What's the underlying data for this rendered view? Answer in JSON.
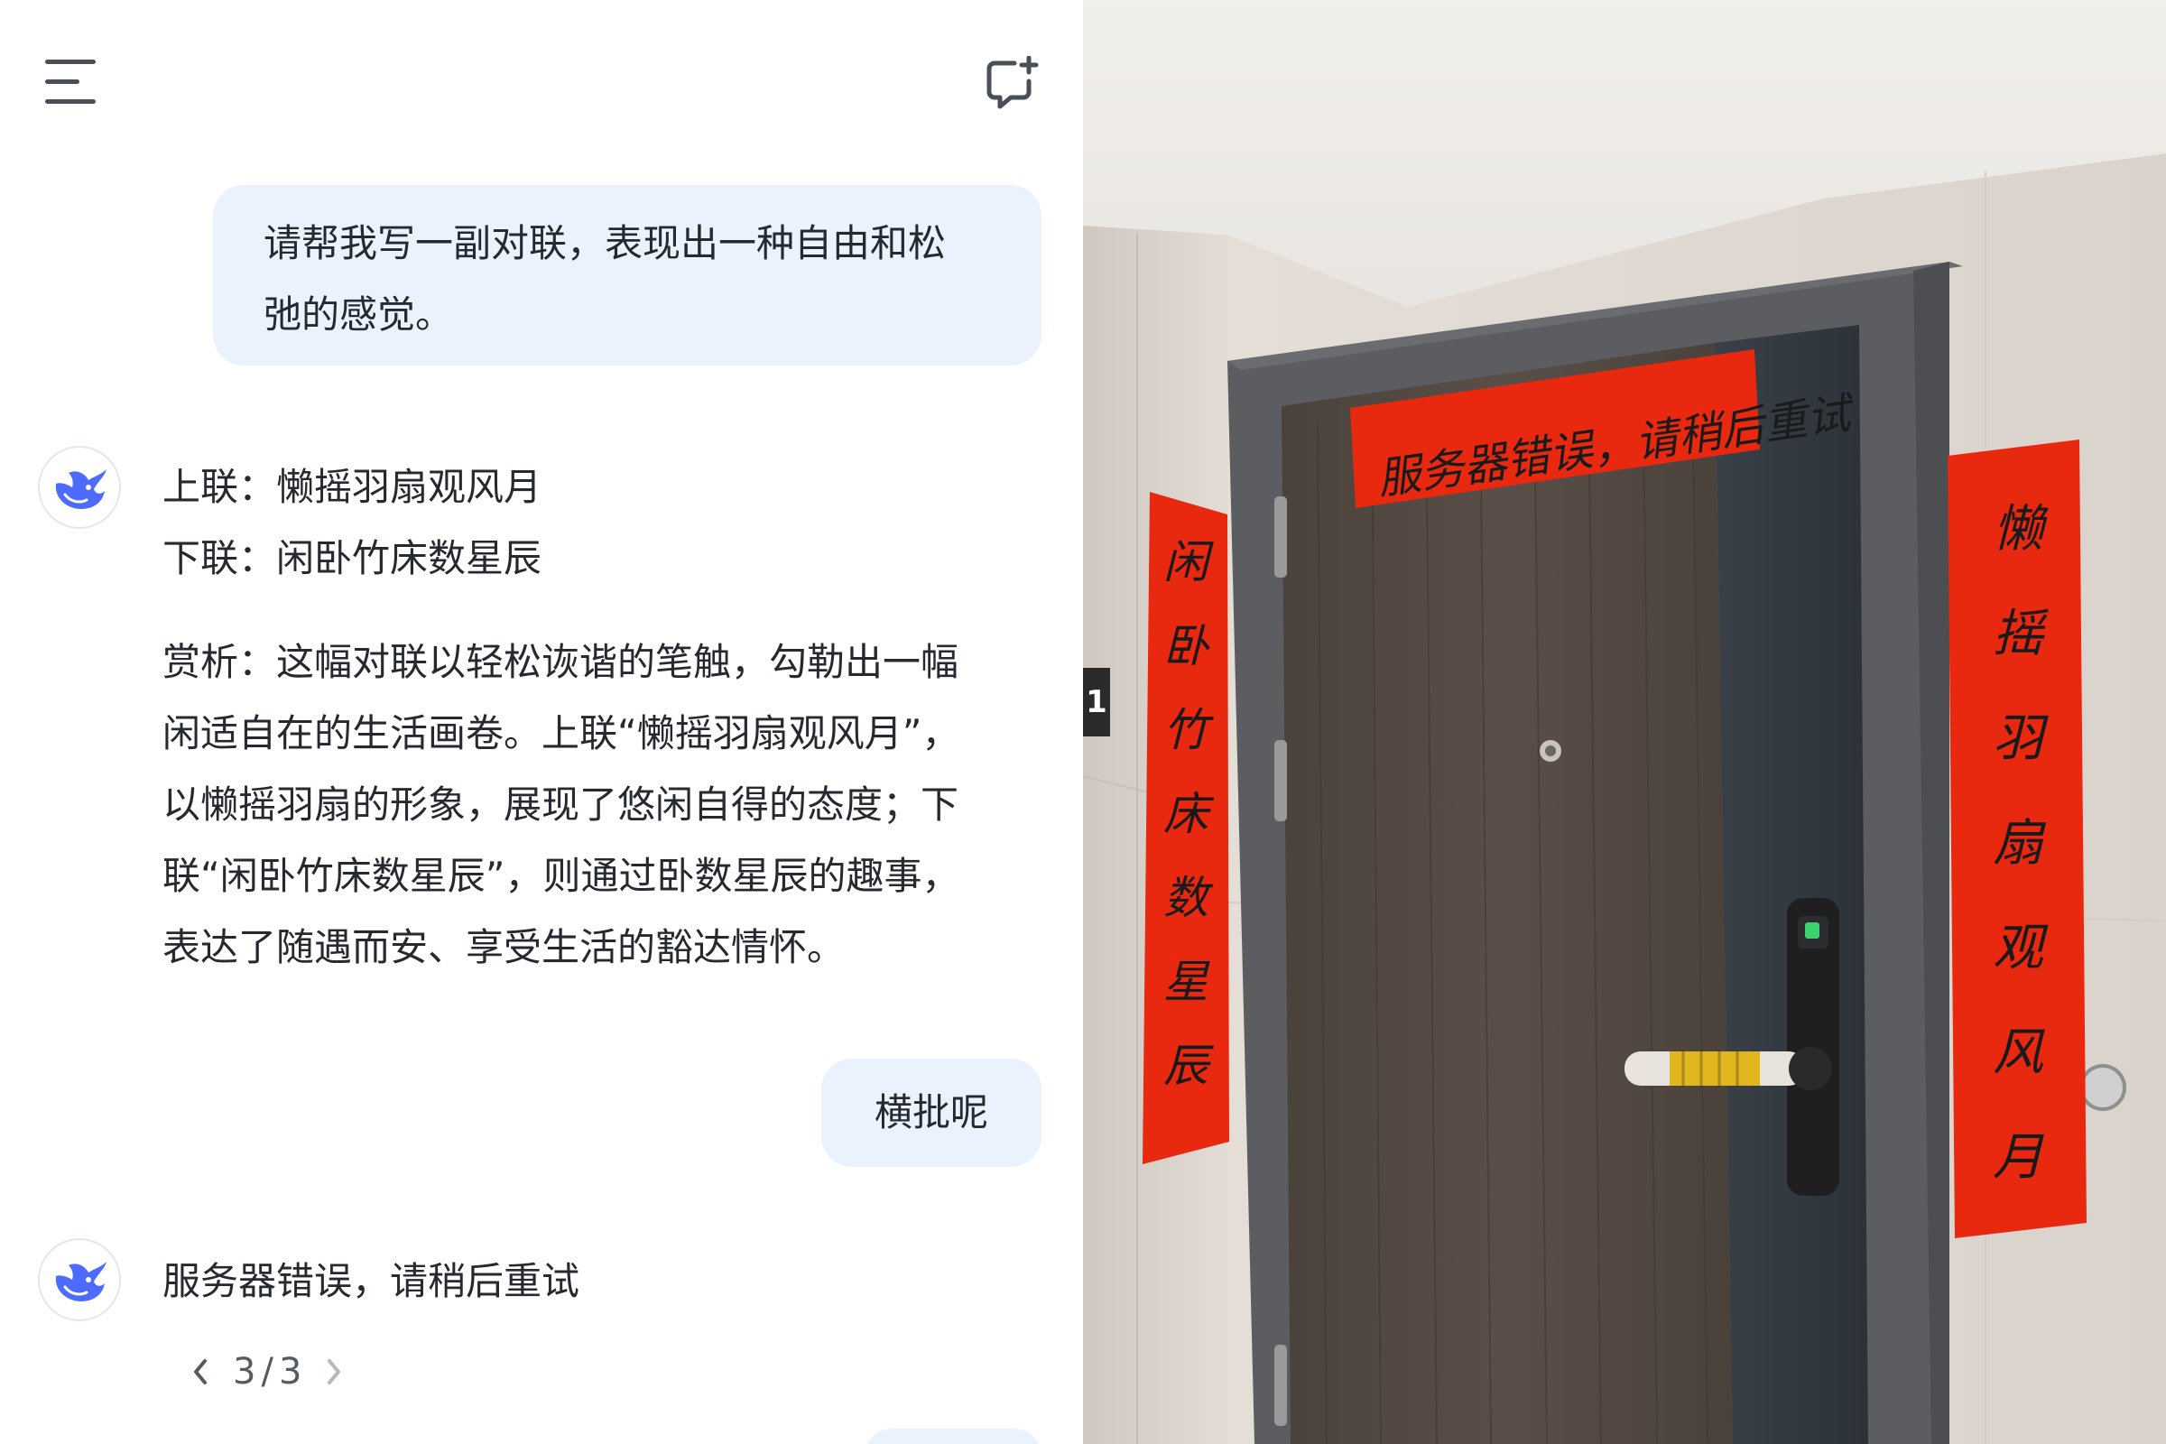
{
  "conversation": {
    "user_message_1": [
      "请帮我写一副对联，表现出一种自由和松",
      "弛的感觉。"
    ],
    "ai_reply_1": {
      "couplet": [
        "上联：懒摇羽扇观风月",
        "下联：闲卧竹床数星辰"
      ],
      "analysis": [
        "赏析：这幅对联以轻松诙谐的笔触，勾勒出一幅",
        "闲适自在的生活画卷。上联“懒摇羽扇观风月”，",
        "以懒摇羽扇的形象，展现了悠闲自得的态度；下",
        "联“闲卧竹床数星辰”，则通过卧数星辰的趣事，",
        "表达了随遇而安、享受生活的豁达情怀。"
      ]
    },
    "user_message_2": "横批呢",
    "ai_reply_2": "服务器错误，请稍后重试",
    "pager": {
      "current": "3",
      "separator": "/",
      "total": "3"
    }
  },
  "photo": {
    "scroll_indicator": "1",
    "top_banner": "服务器错误，请稍后重试",
    "left_scroll": [
      "闲",
      "卧",
      "竹",
      "床",
      "数",
      "星",
      "辰"
    ],
    "right_scroll": [
      "懒",
      "摇",
      "羽",
      "扇",
      "观",
      "风",
      "月"
    ]
  },
  "colors": {
    "user_bubble": "#eaf3fd",
    "text": "#262a30",
    "icon": "#4a4f57",
    "brand": "#4d6bfe",
    "couplet_red": "#e8280f"
  },
  "icons": [
    "menu-icon",
    "new-chat-icon",
    "deepseek-whale-icon",
    "chevron-left-icon",
    "chevron-right-icon"
  ]
}
